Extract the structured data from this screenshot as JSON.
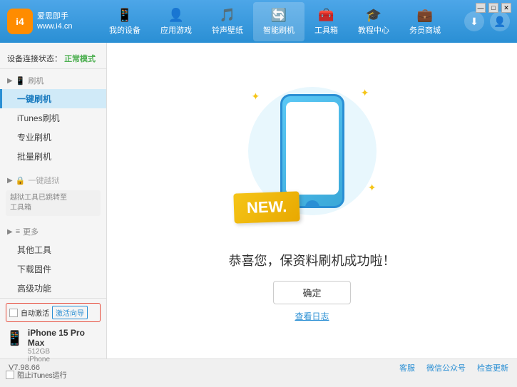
{
  "header": {
    "logo": {
      "icon": "i4",
      "line1": "爱思即手",
      "line2": "www.i4.cn"
    },
    "nav": [
      {
        "id": "my-device",
        "icon": "📱",
        "label": "我的设备"
      },
      {
        "id": "apps-games",
        "icon": "👤",
        "label": "应用游戏"
      },
      {
        "id": "ringtones",
        "icon": "🎵",
        "label": "铃声壁纸"
      },
      {
        "id": "smart-flash",
        "icon": "🔄",
        "label": "智能刷机",
        "active": true
      },
      {
        "id": "toolbox",
        "icon": "🧰",
        "label": "工具箱"
      },
      {
        "id": "tutorial",
        "icon": "🎓",
        "label": "教程中心"
      },
      {
        "id": "business",
        "icon": "💼",
        "label": "务员商城"
      }
    ],
    "right": {
      "download_icon": "⬇",
      "user_icon": "👤"
    }
  },
  "sidebar": {
    "status_label": "设备连接状态：",
    "status_value": "正常模式",
    "groups": [
      {
        "id": "flash",
        "icon": "📱",
        "label": "刷机",
        "expanded": true,
        "items": [
          {
            "id": "one-key-flash",
            "label": "一键刷机",
            "active": true
          },
          {
            "id": "itunes-flash",
            "label": "iTunes刷机"
          },
          {
            "id": "pro-flash",
            "label": "专业刷机"
          },
          {
            "id": "batch-flash",
            "label": "批量刷机"
          }
        ]
      },
      {
        "id": "one-key-jailbreak",
        "icon": "🔒",
        "label": "一键越狱",
        "disabled": true,
        "disabled_msg": "越狱工具已跳转至\n工具箱"
      }
    ],
    "more_group": {
      "icon": "≡",
      "label": "更多",
      "items": [
        {
          "id": "other-tools",
          "label": "其他工具"
        },
        {
          "id": "download-firmware",
          "label": "下载固件"
        },
        {
          "id": "advanced",
          "label": "高级功能"
        }
      ]
    },
    "bottom": {
      "auto_activate_label": "自动激活",
      "guide_btn_label": "激活向导",
      "device_name": "iPhone 15 Pro Max",
      "device_storage": "512GB",
      "device_type": "iPhone",
      "block_itunes_label": "阻止iTunes运行"
    }
  },
  "content": {
    "new_badge": "NEW.",
    "success_message": "恭喜您，保资料刷机成功啦！",
    "confirm_button": "确定",
    "view_log": "查看日志"
  },
  "footer": {
    "version": "V7.98.66",
    "links": [
      {
        "id": "feedback",
        "label": "客服"
      },
      {
        "id": "wechat",
        "label": "微信公众号"
      },
      {
        "id": "check-update",
        "label": "检查更新"
      }
    ]
  }
}
